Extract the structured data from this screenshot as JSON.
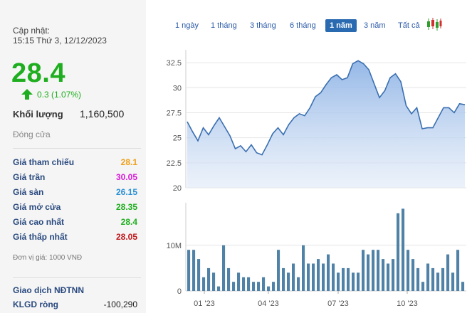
{
  "summary": {
    "update_label": "Cập nhật:",
    "update_time": "15:15 Thứ 3, 12/12/2023",
    "price": "28.4",
    "change": "0.3 (1.07%)",
    "volume_label": "Khối lượng",
    "volume_value": "1,160,500",
    "status": "Đóng cửa"
  },
  "price_rows": [
    {
      "label": "Giá tham chiếu",
      "value": "28.1",
      "color": "#f0a01a"
    },
    {
      "label": "Giá trần",
      "value": "30.05",
      "color": "#d81ad8"
    },
    {
      "label": "Giá sàn",
      "value": "26.15",
      "color": "#2a8fd6"
    },
    {
      "label": "Giá mở cửa",
      "value": "28.35",
      "color": "#1fae1f"
    },
    {
      "label": "Giá cao nhất",
      "value": "28.4",
      "color": "#1fae1f"
    },
    {
      "label": "Giá thấp nhất",
      "value": "28.05",
      "color": "#c0161a"
    }
  ],
  "unit_note": "Đơn vị giá: 1000 VNĐ",
  "foreign": {
    "title": "Giao dịch NĐTNN",
    "net_label": "KLGD ròng",
    "net_value": "-100,290"
  },
  "tabs": [
    "1 ngày",
    "1 tháng",
    "3 tháng",
    "6 tháng",
    "1 năm",
    "3 năm",
    "Tất cả"
  ],
  "active_tab": "1 năm",
  "chart_data": [
    {
      "type": "area",
      "yticks": [
        "20",
        "22.5",
        "25",
        "27.5",
        "30",
        "32.5"
      ],
      "ylim": [
        20,
        33.5
      ],
      "values": [
        26.6,
        25.6,
        24.7,
        26.0,
        25.3,
        26.2,
        27.0,
        26.1,
        25.2,
        23.9,
        24.2,
        23.6,
        24.3,
        23.5,
        23.3,
        24.3,
        25.4,
        26.0,
        25.3,
        26.3,
        27.0,
        27.4,
        27.2,
        28.0,
        29.1,
        29.5,
        30.3,
        31.0,
        31.3,
        30.8,
        31.0,
        32.4,
        32.7,
        32.4,
        31.8,
        30.4,
        29.0,
        29.7,
        31.0,
        31.4,
        30.6,
        28.2,
        27.4,
        28.0,
        25.9,
        26.0,
        26.0,
        27.0,
        28.0,
        28.0,
        27.5,
        28.4,
        28.3
      ],
      "color": "#3a6fb0"
    },
    {
      "type": "bar",
      "yticks": [
        "0",
        "10M"
      ],
      "ylim": [
        0,
        19
      ],
      "xticks": [
        "01 '23",
        "04 '23",
        "07 '23",
        "10 '23"
      ],
      "values": [
        9,
        9,
        7,
        3,
        5,
        4,
        1,
        10,
        5,
        2,
        4,
        3,
        3,
        2,
        2,
        3,
        1,
        2,
        9,
        5,
        4,
        6,
        3,
        10,
        6,
        6,
        7,
        6,
        8,
        6,
        4,
        5,
        5,
        4,
        4,
        9,
        8,
        9,
        9,
        7,
        6,
        7,
        17,
        18,
        9,
        7,
        5,
        2,
        6,
        5,
        4,
        5,
        8,
        4,
        9,
        2
      ],
      "color": "#4f82a6"
    }
  ]
}
